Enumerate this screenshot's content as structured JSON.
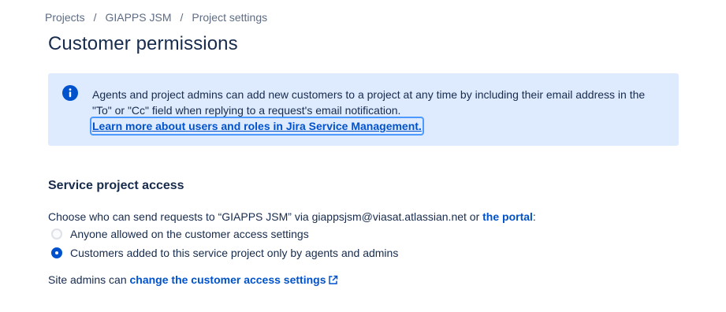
{
  "breadcrumb": {
    "items": [
      "Projects",
      "GIAPPS JSM",
      "Project settings"
    ],
    "separator": "/"
  },
  "page": {
    "title": "Customer permissions"
  },
  "info_panel": {
    "icon": "info-icon",
    "text": "Agents and project admins can add new customers to a project at any time by including their email address in the \"To\" or \"Cc\" field when replying to a request's email notification.",
    "link_label": "Learn more about users and roles in Jira Service Management."
  },
  "service_access": {
    "title": "Service project access",
    "description_prefix": "Choose who can send requests to “GIAPPS JSM” via giappsjsm@viasat.atlassian.net or ",
    "portal_link": "the portal",
    "description_suffix": ":",
    "options": [
      {
        "label": "Anyone allowed on the customer access settings",
        "selected": false
      },
      {
        "label": "Customers added to this service project only by agents and admins",
        "selected": true
      }
    ]
  },
  "site_admins": {
    "prefix": "Site admins can ",
    "link_label": "change the customer access settings",
    "icon": "external-link-icon"
  },
  "colors": {
    "accent": "#0052cc",
    "info_bg": "#deebff",
    "text": "#172b4d",
    "muted": "#5e6c84"
  }
}
